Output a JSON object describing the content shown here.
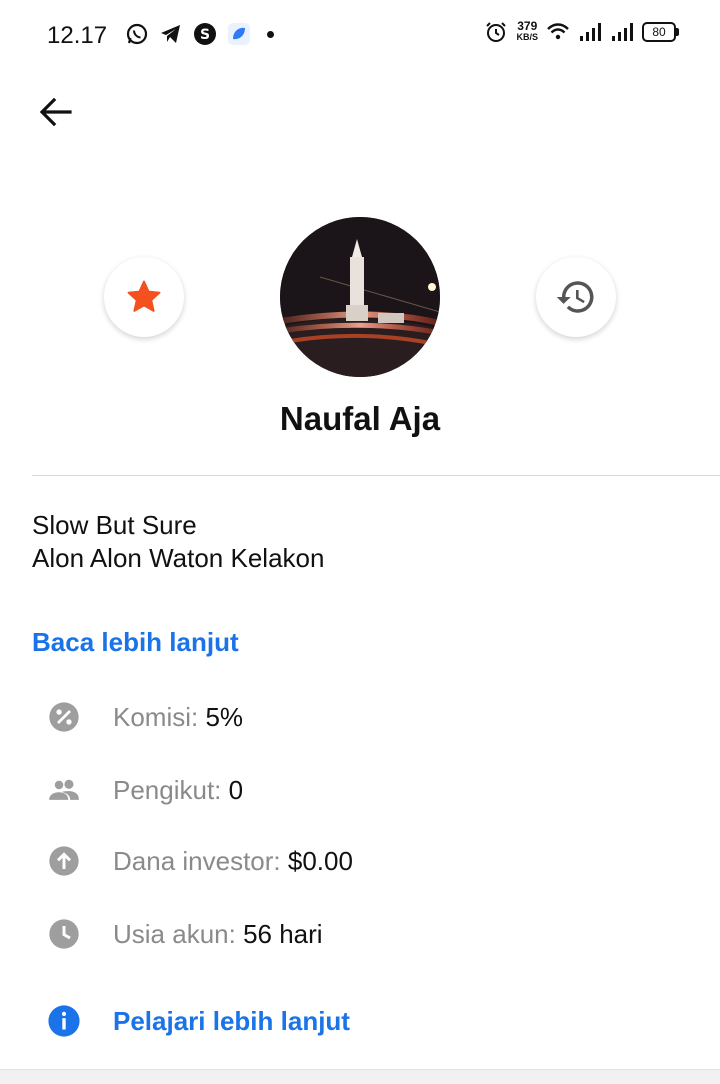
{
  "statusbar": {
    "time": "12.17",
    "net_speed": "379",
    "net_unit": "KB/S",
    "battery": "80"
  },
  "profile": {
    "name": "Naufal Aja",
    "bio_line1": "Slow But Sure",
    "bio_line2": "Alon Alon Waton Kelakon",
    "read_more": "Baca lebih lanjut"
  },
  "stats": [
    {
      "icon": "percent-icon",
      "label": "Komisi: ",
      "value": "5%"
    },
    {
      "icon": "people-icon",
      "label": "Pengikut: ",
      "value": "0"
    },
    {
      "icon": "arrow-up-circle-icon",
      "label": "Dana investor: ",
      "value": "$0.00"
    },
    {
      "icon": "clock-icon",
      "label": "Usia akun: ",
      "value": "56 hari"
    }
  ],
  "learn_more": "Pelajari lebih lanjut",
  "colors": {
    "accent": "#1a73e8",
    "star": "#f4511e",
    "icon_gray": "#9e9e9e",
    "label_gray": "#8a8a8a"
  }
}
